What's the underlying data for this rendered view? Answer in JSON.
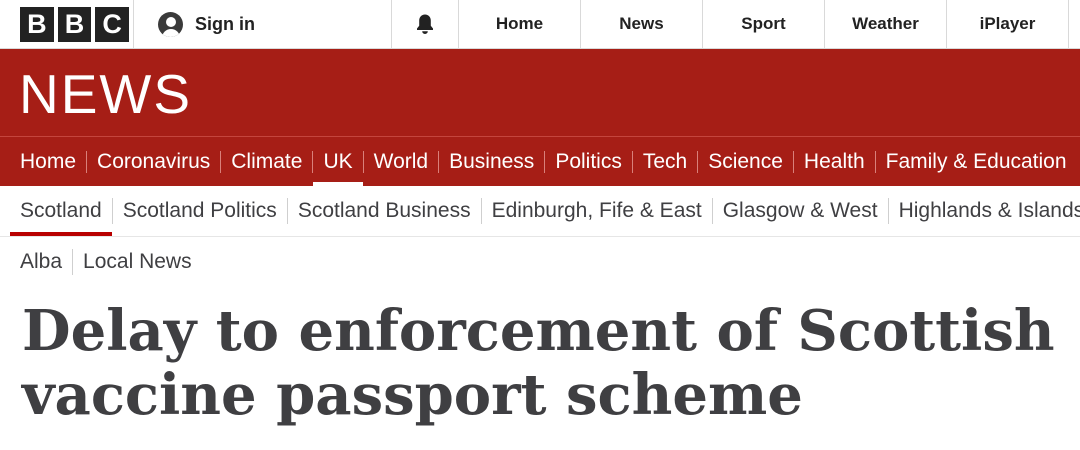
{
  "masthead": {
    "logo": [
      "B",
      "B",
      "C"
    ],
    "sign_in": "Sign in",
    "bell": "bell-icon",
    "nav": [
      "Home",
      "News",
      "Sport",
      "Weather",
      "iPlayer"
    ]
  },
  "banner": {
    "title": "NEWS"
  },
  "primary_nav": {
    "active": "UK",
    "items": [
      "Home",
      "Coronavirus",
      "Climate",
      "UK",
      "World",
      "Business",
      "Politics",
      "Tech",
      "Science",
      "Health",
      "Family & Education"
    ]
  },
  "secondary_nav": {
    "active": "Scotland",
    "items": [
      "Scotland",
      "Scotland Politics",
      "Scotland Business",
      "Edinburgh, Fife & East",
      "Glasgow & West",
      "Highlands & Islands"
    ],
    "items_row2": [
      "Alba",
      "Local News"
    ]
  },
  "article": {
    "headline": "Delay to enforcement of Scottish vaccine passport scheme"
  },
  "colors": {
    "brand_red": "#a61e16",
    "active_underline": "#b80000",
    "text_dark": "#3f3f42"
  }
}
